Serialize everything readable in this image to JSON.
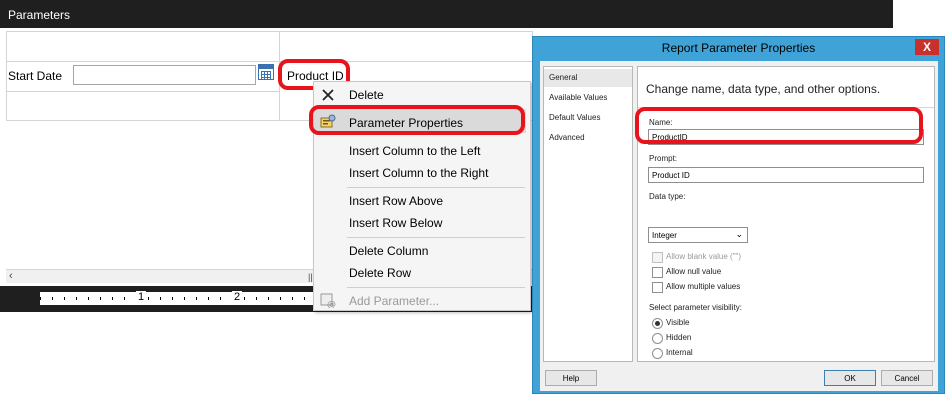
{
  "params_pane": {
    "title": "Parameters",
    "start_date_label": "Start Date",
    "start_date_value": "",
    "product_cell_label": "Product ID"
  },
  "ruler": {
    "marks": [
      "1",
      "2"
    ]
  },
  "context_menu": {
    "items": [
      {
        "label": "Delete",
        "icon": "delete-x-icon"
      },
      {
        "label": "Parameter Properties",
        "icon": "parameter-properties-icon",
        "highlighted": true
      },
      {
        "label": "Insert Column to the Left"
      },
      {
        "label": "Insert Column to the Right"
      },
      {
        "label": "Insert Row Above"
      },
      {
        "label": "Insert Row Below"
      },
      {
        "label": "Delete Column"
      },
      {
        "label": "Delete Row"
      },
      {
        "label": "Add Parameter...",
        "icon": "add-parameter-icon",
        "disabled": true
      }
    ]
  },
  "dialog": {
    "title": "Report Parameter Properties",
    "close_glyph": "X",
    "nav": [
      "General",
      "Available Values",
      "Default Values",
      "Advanced"
    ],
    "selected_nav": "General",
    "heading": "Change name, data type, and other options.",
    "name_label": "Name:",
    "name_value": "ProductID",
    "prompt_label": "Prompt:",
    "prompt_value": "Product ID",
    "data_type_label": "Data type:",
    "data_type_value": "Integer",
    "checkboxes": [
      {
        "label": "Allow blank value (\"\")",
        "checked": false,
        "disabled": true
      },
      {
        "label": "Allow null value",
        "checked": false,
        "disabled": false
      },
      {
        "label": "Allow multiple values",
        "checked": false,
        "disabled": false
      }
    ],
    "visibility_label": "Select parameter visibility:",
    "visibility_options": [
      "Visible",
      "Hidden",
      "Internal"
    ],
    "visibility_selected": "Visible",
    "help_button": "Help",
    "ok_button": "OK",
    "cancel_button": "Cancel"
  },
  "colors": {
    "highlight_outline": "#e8141b",
    "dialog_frame": "#3fa3d8",
    "pane_bar": "#1f1f1f"
  }
}
